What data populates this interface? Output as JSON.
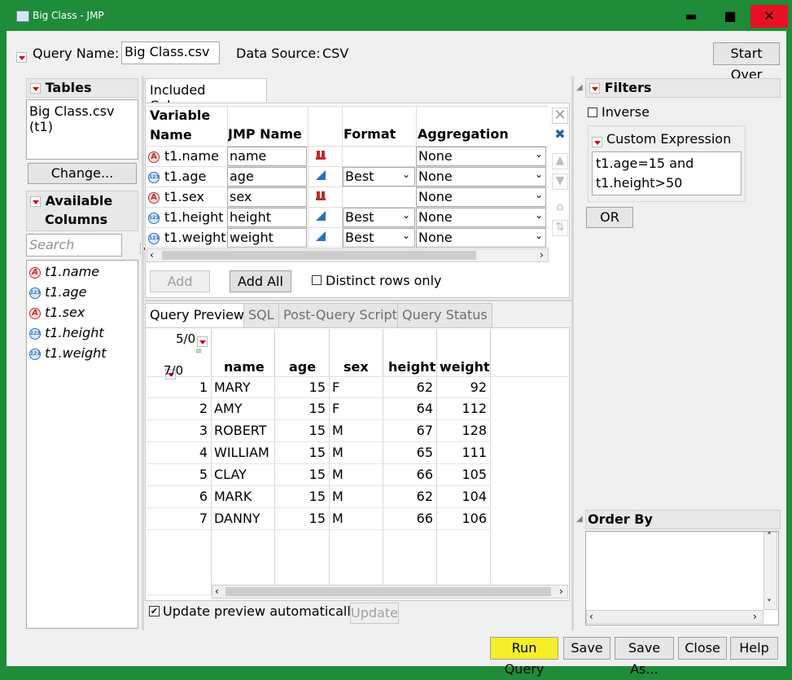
{
  "window": {
    "title": "Big Class - JMP",
    "minimize": "▬",
    "maximize": "■",
    "close": "✕"
  },
  "query": {
    "name_label": "Query Name:",
    "name_value": "Big Class.csv",
    "source_label": "Data Source:",
    "source_value": "CSV",
    "start_over": "Start Over"
  },
  "tables": {
    "header": "Tables",
    "items": [
      "Big Class.csv (t1)"
    ],
    "change_button": "Change..."
  },
  "available": {
    "header_line1": "Available",
    "header_line2": "Columns",
    "search_placeholder": "Search",
    "columns": [
      {
        "name": "t1.name",
        "type": "char"
      },
      {
        "name": "t1.age",
        "type": "num"
      },
      {
        "name": "t1.sex",
        "type": "char"
      },
      {
        "name": "t1.height",
        "type": "num"
      },
      {
        "name": "t1.weight",
        "type": "num"
      }
    ]
  },
  "included": {
    "tab": "Included Columns",
    "headers": {
      "variable_line1": "Variable",
      "variable_line2": "Name",
      "jmp_name": "JMP Name",
      "format": "Format",
      "aggregation": "Aggregation"
    },
    "rows": [
      {
        "variable": "t1.name",
        "jmp": "name",
        "format": "",
        "agg": "None",
        "type": "char"
      },
      {
        "variable": "t1.age",
        "jmp": "age",
        "format": "Best",
        "agg": "None",
        "type": "num"
      },
      {
        "variable": "t1.sex",
        "jmp": "sex",
        "format": "",
        "agg": "None",
        "type": "char"
      },
      {
        "variable": "t1.height",
        "jmp": "height",
        "format": "Best",
        "agg": "None",
        "type": "num"
      },
      {
        "variable": "t1.weight",
        "jmp": "weight",
        "format": "Best",
        "agg": "None",
        "type": "num"
      }
    ],
    "add": "Add",
    "add_all": "Add All",
    "distinct": "Distinct rows only"
  },
  "preview": {
    "tabs": [
      "Query Preview",
      "SQL",
      "Post-Query Script",
      "Query Status"
    ],
    "cols_count": "5/0",
    "rows_count": "7/0",
    "headers": [
      "name",
      "age",
      "sex",
      "height",
      "weight"
    ],
    "rows": [
      [
        "1",
        "MARY",
        "15",
        "F",
        "62",
        "92"
      ],
      [
        "2",
        "AMY",
        "15",
        "F",
        "64",
        "112"
      ],
      [
        "3",
        "ROBERT",
        "15",
        "M",
        "67",
        "128"
      ],
      [
        "4",
        "WILLIAM",
        "15",
        "M",
        "65",
        "111"
      ],
      [
        "5",
        "CLAY",
        "15",
        "M",
        "66",
        "105"
      ],
      [
        "6",
        "MARK",
        "15",
        "M",
        "62",
        "104"
      ],
      [
        "7",
        "DANNY",
        "15",
        "M",
        "66",
        "106"
      ]
    ],
    "update_auto": "Update preview automatically",
    "update": "Update"
  },
  "filters": {
    "header": "Filters",
    "inverse": "Inverse",
    "custom_label": "Custom Expression",
    "expression_line1": "t1.age=15 and",
    "expression_line2": "t1.height>50",
    "or_button": "OR"
  },
  "order_by": {
    "header": "Order By"
  },
  "footer": {
    "run": "Run Query",
    "save": "Save",
    "save_as": "Save As...",
    "close": "Close",
    "help": "Help"
  },
  "colors": {
    "title_bar": "#1e8c38",
    "close_button": "#e81123",
    "run_highlight": "#f5ef2a"
  }
}
